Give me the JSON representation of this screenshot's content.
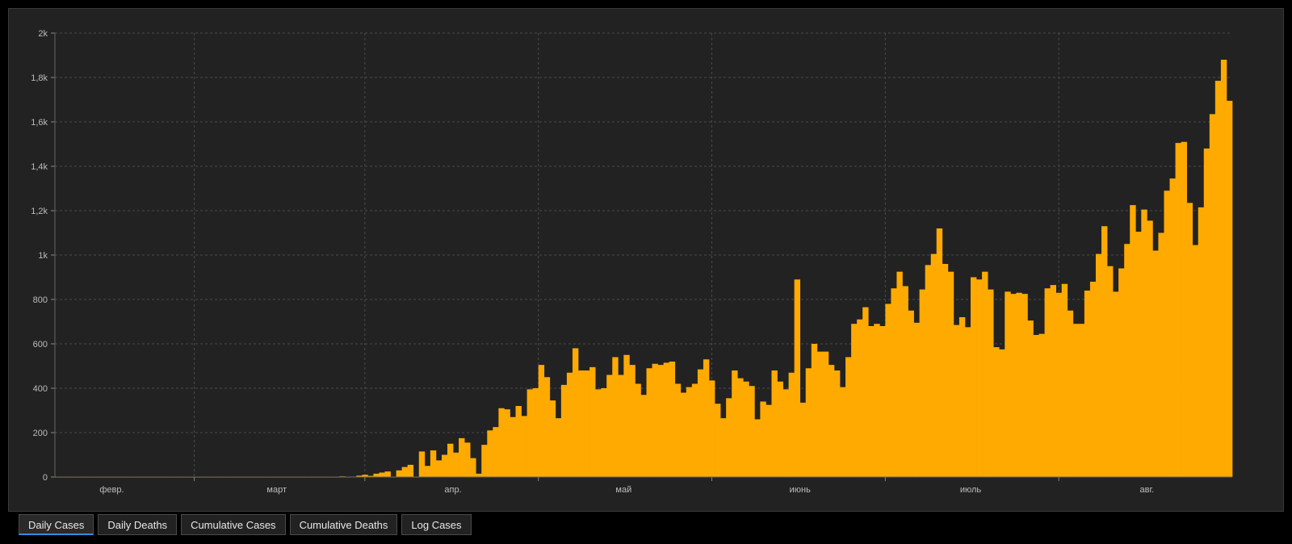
{
  "colors": {
    "background": "#000000",
    "panel": "#222222",
    "bar": "#ffaa00",
    "grid": "#4a4a4a",
    "tick_text": "#bdbdbd",
    "active_tab_underline": "#2f8fe0"
  },
  "tabs": [
    {
      "label": "Daily Cases",
      "active": true
    },
    {
      "label": "Daily Deaths",
      "active": false
    },
    {
      "label": "Cumulative Cases",
      "active": false
    },
    {
      "label": "Cumulative Deaths",
      "active": false
    },
    {
      "label": "Log Cases",
      "active": false
    }
  ],
  "chart_data": {
    "type": "bar",
    "title": "",
    "xlabel": "",
    "ylabel": "",
    "ylim": [
      0,
      2000
    ],
    "y_ticks": [
      {
        "value": 0,
        "label": "0"
      },
      {
        "value": 200,
        "label": "200"
      },
      {
        "value": 400,
        "label": "400"
      },
      {
        "value": 600,
        "label": "600"
      },
      {
        "value": 800,
        "label": "800"
      },
      {
        "value": 1000,
        "label": "1k"
      },
      {
        "value": 1200,
        "label": "1,2k"
      },
      {
        "value": 1400,
        "label": "1,4k"
      },
      {
        "value": 1600,
        "label": "1,6k"
      },
      {
        "value": 1800,
        "label": "1,8k"
      },
      {
        "value": 2000,
        "label": "2k"
      }
    ],
    "x_start_date": "2020-01-22",
    "x_end_date": "2020-08-01",
    "x_ticks": [
      {
        "date": "2020-02-01",
        "label": "февр."
      },
      {
        "date": "2020-03-01",
        "label": "март"
      },
      {
        "date": "2020-04-01",
        "label": "апр."
      },
      {
        "date": "2020-05-01",
        "label": "май"
      },
      {
        "date": "2020-06-01",
        "label": "июнь"
      },
      {
        "date": "2020-07-01",
        "label": "июль"
      },
      {
        "date": "2020-08-01",
        "label": "авг."
      }
    ],
    "grid": true,
    "legend": "none",
    "values": [
      0,
      0,
      0,
      0,
      0,
      0,
      0,
      0,
      0,
      0,
      0,
      0,
      0,
      0,
      0,
      0,
      0,
      0,
      0,
      0,
      0,
      0,
      0,
      0,
      0,
      0,
      0,
      0,
      0,
      0,
      0,
      0,
      0,
      0,
      0,
      0,
      0,
      0,
      0,
      0,
      0,
      0,
      0,
      0,
      0,
      0,
      0,
      0,
      0,
      0,
      3,
      0,
      2,
      6,
      10,
      5,
      15,
      20,
      25,
      0,
      30,
      45,
      55,
      0,
      115,
      50,
      120,
      75,
      100,
      150,
      110,
      175,
      155,
      85,
      15,
      145,
      210,
      225,
      310,
      305,
      270,
      320,
      275,
      395,
      400,
      505,
      450,
      345,
      265,
      415,
      470,
      580,
      480,
      480,
      495,
      395,
      400,
      460,
      540,
      460,
      550,
      505,
      420,
      370,
      490,
      510,
      505,
      515,
      520,
      420,
      380,
      405,
      420,
      485,
      530,
      435,
      330,
      265,
      355,
      480,
      445,
      430,
      410,
      260,
      340,
      325,
      480,
      430,
      395,
      470,
      890,
      335,
      490,
      600,
      565,
      565,
      505,
      480,
      405,
      540,
      690,
      710,
      765,
      680,
      690,
      680,
      780,
      850,
      925,
      860,
      750,
      695,
      845,
      955,
      1005,
      1120,
      960,
      925,
      685,
      720,
      675,
      900,
      890,
      925,
      845,
      585,
      575,
      835,
      825,
      830,
      825,
      705,
      640,
      645,
      850,
      865,
      830,
      870,
      750,
      690,
      690,
      840,
      880,
      1005,
      1130,
      950,
      835,
      940,
      1050,
      1225,
      1105,
      1205,
      1155,
      1020,
      1100,
      1290,
      1345,
      1505,
      1510,
      1235,
      1045,
      1215,
      1480,
      1635,
      1785,
      1880,
      1695
    ]
  }
}
